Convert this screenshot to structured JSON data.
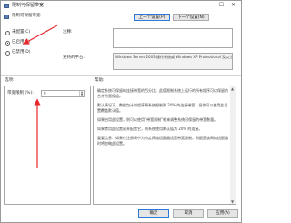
{
  "window": {
    "title": "限制可保留带宽",
    "controls": {
      "minimize": "—",
      "maximize": "☐",
      "close": "✕"
    }
  },
  "header": {
    "setting_name": "限制可保留带宽",
    "prev_button": "上一个设置(P)",
    "next_button": "下一个设置(N)"
  },
  "state_options": [
    {
      "label": "未配置(C)",
      "selected": false
    },
    {
      "label": "已启用(E)",
      "selected": true
    },
    {
      "label": "已禁用(D)",
      "selected": false
    }
  ],
  "comment": {
    "label": "注释:",
    "value": ""
  },
  "supported": {
    "label": "支持的平台:",
    "value": "Windows Server 2003 操作系统或 Windows XP Professional 及以上版本"
  },
  "sections": {
    "options": "选项:",
    "help": "帮助:"
  },
  "bandwidth": {
    "label": "带宽限制 (%):",
    "value": "0"
  },
  "help_paragraphs": [
    "确定系统可保留的连接带宽的百分比。此值限制系统上运行的所有程序可以保留的合并带宽保留。",
    "默认情况下，数据包计划程序将系统限制到 20% 的连接带宽，但你可以使用此设置覆盖默认值。",
    "如果启用此设置，则可以使用“带宽限制”框来调整系统可保留的带宽数量。",
    "如果禁用此设置或未配置它，则系统使用默认值为 20% 的连接。",
    "重要信息：如果在注册表中为特定网络适配器设置带宽限制，则配置该网络适配器时将忽略此设置。"
  ],
  "footer": {
    "ok": "确定",
    "cancel": "取消",
    "apply": "应用(A)"
  },
  "colors": {
    "annotation_arrow": "#e8272c",
    "primary_border": "#2b79d8"
  }
}
